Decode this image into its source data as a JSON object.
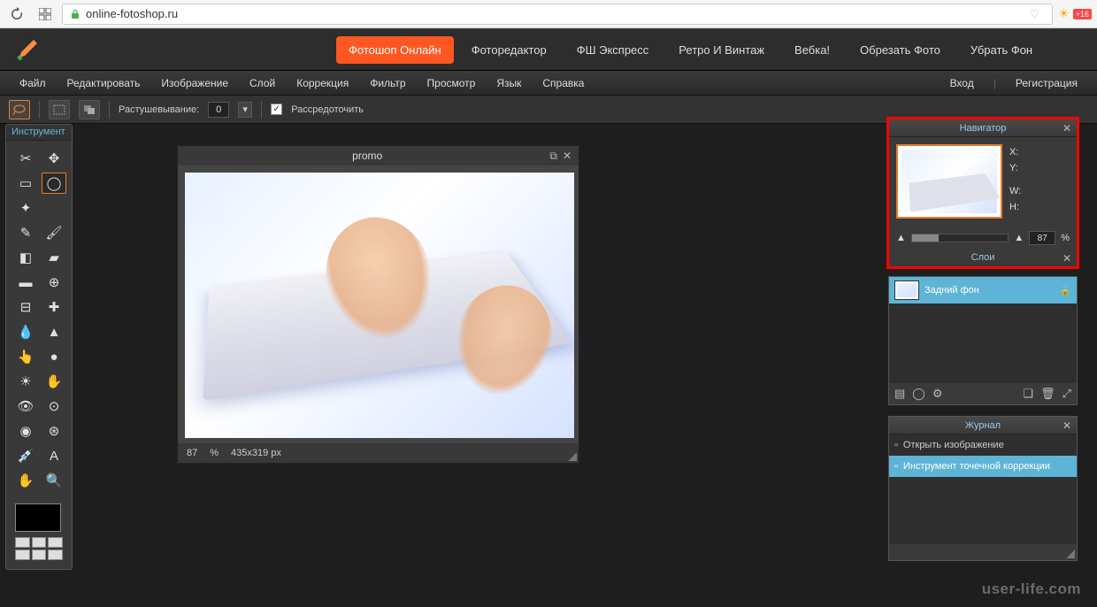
{
  "browser": {
    "url": "online-fotoshop.ru",
    "ext_badge": "+16"
  },
  "topnav": {
    "items": [
      "Фотошоп Онлайн",
      "Фоторедактор",
      "ФШ Экспресс",
      "Ретро И Винтаж",
      "Вебка!",
      "Обрезать Фото",
      "Убрать Фон"
    ],
    "active_index": 0
  },
  "menubar": {
    "items": [
      "Файл",
      "Редактировать",
      "Изображение",
      "Слой",
      "Коррекция",
      "Фильтр",
      "Просмотр",
      "Язык",
      "Справка"
    ],
    "login": "Вход",
    "register": "Регистрация"
  },
  "options": {
    "feather_label": "Растушевывание:",
    "feather_value": "0",
    "spread_label": "Рассредоточить",
    "spread_checked": true
  },
  "tools": {
    "header": "Инструмент",
    "selected_index": 3,
    "items": [
      {
        "name": "crop",
        "glyph": "✂"
      },
      {
        "name": "move",
        "glyph": "✥"
      },
      {
        "name": "marquee",
        "glyph": "▭"
      },
      {
        "name": "lasso",
        "glyph": "◯"
      },
      {
        "name": "wand",
        "glyph": "✦"
      },
      {
        "name": "blank1",
        "glyph": ""
      },
      {
        "name": "pencil",
        "glyph": "✎"
      },
      {
        "name": "brush",
        "glyph": "🖌"
      },
      {
        "name": "eraser",
        "glyph": "◧"
      },
      {
        "name": "paint",
        "glyph": "▰"
      },
      {
        "name": "gradient",
        "glyph": "▬"
      },
      {
        "name": "clone",
        "glyph": "⊕"
      },
      {
        "name": "stamp",
        "glyph": "⊟"
      },
      {
        "name": "heal",
        "glyph": "✚"
      },
      {
        "name": "blur",
        "glyph": "💧"
      },
      {
        "name": "sharpen",
        "glyph": "▲"
      },
      {
        "name": "smudge",
        "glyph": "👆"
      },
      {
        "name": "sponge",
        "glyph": "●"
      },
      {
        "name": "dodge",
        "glyph": "☀"
      },
      {
        "name": "burn",
        "glyph": "✋"
      },
      {
        "name": "redeye",
        "glyph": "👁"
      },
      {
        "name": "spot",
        "glyph": "⊙"
      },
      {
        "name": "bloat",
        "glyph": "◉"
      },
      {
        "name": "pinch",
        "glyph": "⊛"
      },
      {
        "name": "picker",
        "glyph": "💉"
      },
      {
        "name": "type",
        "glyph": "A"
      },
      {
        "name": "hand",
        "glyph": "✋"
      },
      {
        "name": "zoom",
        "glyph": "🔍"
      }
    ]
  },
  "canvas": {
    "title": "promo",
    "zoom_value": "87",
    "zoom_pct": "%",
    "dimensions": "435x319 px"
  },
  "navigator": {
    "title": "Навигатор",
    "x_label": "X:",
    "y_label": "Y:",
    "w_label": "W:",
    "h_label": "H:",
    "zoom_value": "87",
    "zoom_pct": "%"
  },
  "layers": {
    "title": "Слои",
    "items": [
      {
        "name": "Задний фон",
        "locked": true
      }
    ]
  },
  "history": {
    "title": "Журнал",
    "items": [
      {
        "label": "Открыть изображение",
        "active": false
      },
      {
        "label": "Инструмент точечной коррекции",
        "active": true
      }
    ]
  },
  "watermark": "user-life.com"
}
